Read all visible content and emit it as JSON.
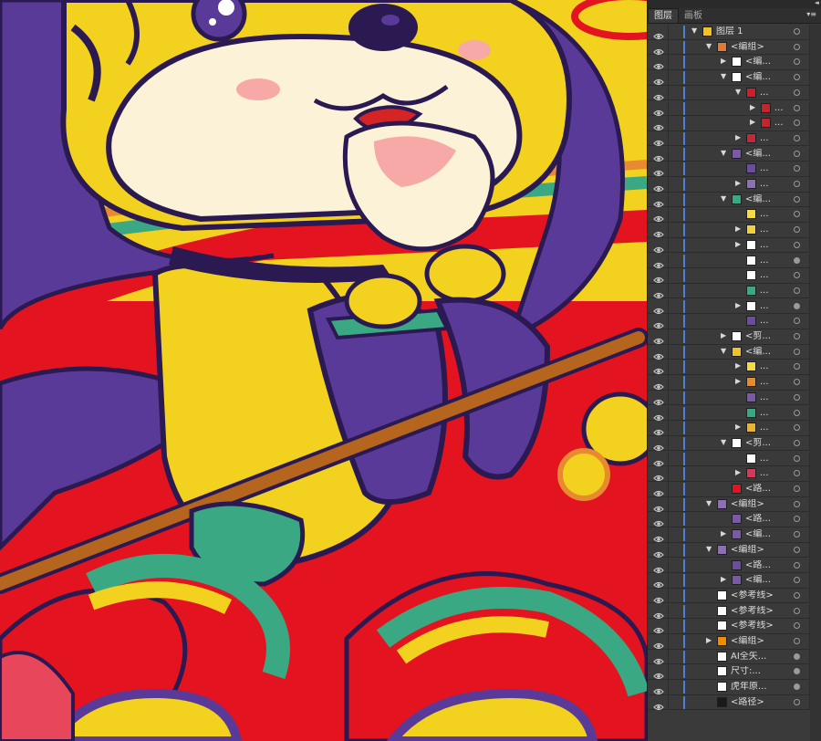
{
  "panel": {
    "collapse_label": "◂◂",
    "tabs": [
      {
        "label": "图层",
        "active": true
      },
      {
        "label": "画板",
        "active": false
      }
    ],
    "menu_icon": "panel-menu-icon",
    "selection_color": "#4f7ed9"
  },
  "layers": [
    {
      "name": "图层 1",
      "indent": 0,
      "expand": "down",
      "thumb": "#f3c02a",
      "target": false
    },
    {
      "name": "<编组>",
      "indent": 1,
      "expand": "down",
      "thumb": "#e37a34",
      "target": false
    },
    {
      "name": "<编...",
      "indent": 2,
      "expand": "right",
      "thumb": "#ffffff",
      "target": false
    },
    {
      "name": "<编...",
      "indent": 2,
      "expand": "down",
      "thumb": "#ffffff",
      "target": false
    },
    {
      "name": "...",
      "indent": 3,
      "expand": "down",
      "thumb": "#d21c2a",
      "target": false
    },
    {
      "name": "...",
      "indent": 4,
      "expand": "right",
      "thumb": "#c12530",
      "target": false
    },
    {
      "name": "...",
      "indent": 4,
      "expand": "right",
      "thumb": "#c12530",
      "target": false
    },
    {
      "name": "...",
      "indent": 3,
      "expand": "right",
      "thumb": "#c2283a",
      "target": false
    },
    {
      "name": "<编...",
      "indent": 2,
      "expand": "down",
      "thumb": "#7c59a8",
      "target": false
    },
    {
      "name": "...",
      "indent": 3,
      "expand": "none",
      "thumb": "#6a4ca0",
      "target": false
    },
    {
      "name": "...",
      "indent": 3,
      "expand": "right",
      "thumb": "#8d6fb8",
      "target": false
    },
    {
      "name": "<编...",
      "indent": 2,
      "expand": "down",
      "thumb": "#3aa883",
      "target": false
    },
    {
      "name": "...",
      "indent": 3,
      "expand": "none",
      "thumb": "#f4dd3a",
      "target": false
    },
    {
      "name": "...",
      "indent": 3,
      "expand": "right",
      "thumb": "#f1d03b",
      "target": false
    },
    {
      "name": "...",
      "indent": 3,
      "expand": "right",
      "thumb": "#ffffff",
      "target": false
    },
    {
      "name": "...",
      "indent": 3,
      "expand": "none",
      "thumb": "#ffffff",
      "target": true
    },
    {
      "name": "...",
      "indent": 3,
      "expand": "none",
      "thumb": "#ffffff",
      "target": false
    },
    {
      "name": "...",
      "indent": 3,
      "expand": "none",
      "thumb": "#3aa883",
      "target": false
    },
    {
      "name": "...",
      "indent": 3,
      "expand": "right",
      "thumb": "#ffffff",
      "target": true
    },
    {
      "name": "...",
      "indent": 3,
      "expand": "none",
      "thumb": "#6a4ca0",
      "target": false
    },
    {
      "name": "<剪...",
      "indent": 2,
      "expand": "right",
      "thumb": "#ffffff",
      "target": false
    },
    {
      "name": "<编...",
      "indent": 2,
      "expand": "down",
      "thumb": "#f3c02a",
      "target": false
    },
    {
      "name": "...",
      "indent": 3,
      "expand": "right",
      "thumb": "#f4dd3a",
      "target": false
    },
    {
      "name": "...",
      "indent": 3,
      "expand": "right",
      "thumb": "#e38c2f",
      "target": false
    },
    {
      "name": "...",
      "indent": 3,
      "expand": "none",
      "thumb": "#7c59a8",
      "target": false
    },
    {
      "name": "...",
      "indent": 3,
      "expand": "none",
      "thumb": "#3aa883",
      "target": false
    },
    {
      "name": "...",
      "indent": 3,
      "expand": "right",
      "thumb": "#e6b334",
      "target": false
    },
    {
      "name": "<剪...",
      "indent": 2,
      "expand": "down",
      "thumb": "#ffffff",
      "target": false
    },
    {
      "name": "...",
      "indent": 3,
      "expand": "none",
      "thumb": "#ffffff",
      "target": false
    },
    {
      "name": "...",
      "indent": 3,
      "expand": "right",
      "thumb": "#d23a5a",
      "target": false
    },
    {
      "name": "<路...",
      "indent": 2,
      "expand": "none",
      "thumb": "#e3141f",
      "target": false
    },
    {
      "name": "<编组>",
      "indent": 1,
      "expand": "down",
      "thumb": "#8d6fb8",
      "target": false
    },
    {
      "name": "<路...",
      "indent": 2,
      "expand": "none",
      "thumb": "#7c59a8",
      "target": false
    },
    {
      "name": "<编...",
      "indent": 2,
      "expand": "right",
      "thumb": "#7c59a8",
      "target": false
    },
    {
      "name": "<编组>",
      "indent": 1,
      "expand": "down",
      "thumb": "#8d6fb8",
      "target": false
    },
    {
      "name": "<路...",
      "indent": 2,
      "expand": "none",
      "thumb": "#6a4ca0",
      "target": false
    },
    {
      "name": "<编...",
      "indent": 2,
      "expand": "right",
      "thumb": "#7c59a8",
      "target": false
    },
    {
      "name": "<参考线>",
      "indent": 1,
      "expand": "none",
      "thumb": "#ffffff",
      "target": false
    },
    {
      "name": "<参考线>",
      "indent": 1,
      "expand": "none",
      "thumb": "#ffffff",
      "target": false
    },
    {
      "name": "<参考线>",
      "indent": 1,
      "expand": "none",
      "thumb": "#ffffff",
      "target": false
    },
    {
      "name": "<编组>",
      "indent": 1,
      "expand": "right",
      "thumb": "#f08c00",
      "target": false
    },
    {
      "name": "AI全矢...",
      "indent": 1,
      "expand": "none",
      "thumb": "#ffffff",
      "target": true
    },
    {
      "name": "尺寸:...",
      "indent": 1,
      "expand": "none",
      "thumb": "#ffffff",
      "target": true
    },
    {
      "name": "虎年原...",
      "indent": 1,
      "expand": "none",
      "thumb": "#ffffff",
      "target": true
    },
    {
      "name": "<路径>",
      "indent": 1,
      "expand": "none",
      "thumb": "#1a1a1a",
      "target": false
    }
  ]
}
